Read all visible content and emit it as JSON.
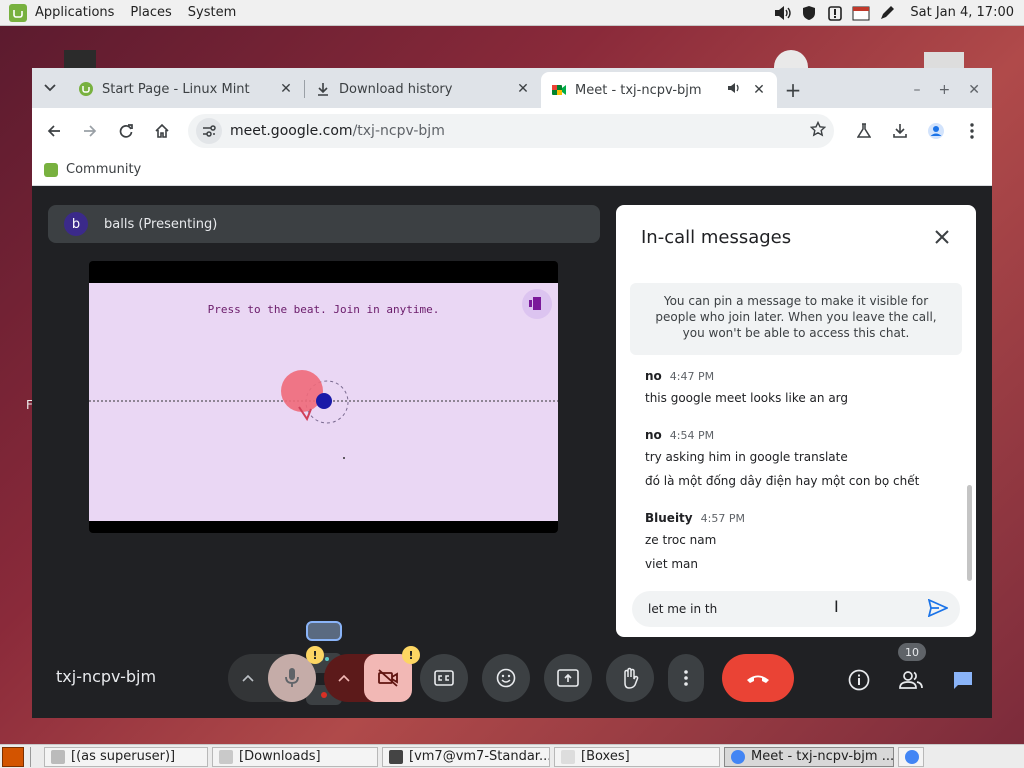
{
  "system_panel": {
    "menus": [
      "Applications",
      "Places",
      "System"
    ],
    "clock": "Sat Jan  4, 17:00"
  },
  "browser": {
    "tabs": [
      {
        "title": "Start Page - Linux Mint",
        "icon": "linux-mint-icon"
      },
      {
        "title": "Download history",
        "icon": "download-icon"
      },
      {
        "title": "Meet - txj-ncpv-bjm",
        "icon": "google-meet-icon",
        "audio": true
      }
    ],
    "url_host": "meet.google.com",
    "url_path": "/txj-ncpv-bjm",
    "bookmark": "Community"
  },
  "meet": {
    "presenter_initial": "b",
    "presenter_label": "balls (Presenting)",
    "slide_caption": "Press to the beat. Join in anytime.",
    "meeting_code": "txj-ncpv-bjm",
    "participant_count": "10",
    "warning_mark": "!"
  },
  "chat": {
    "title": "In-call messages",
    "info": "You can pin a message to make it visible for people who join later. When you leave the call, you won't be able to access this chat.",
    "groups": [
      {
        "sender": "no",
        "time": "4:47 PM",
        "lines": [
          "this google meet looks like an arg"
        ]
      },
      {
        "sender": "no",
        "time": "4:54 PM",
        "lines": [
          "try asking him in google translate",
          "đó là một đống dây điện hay một con bọ chết"
        ]
      },
      {
        "sender": "Blueity",
        "time": "4:57 PM",
        "lines": [
          "ze troc nam",
          "viet man"
        ]
      }
    ],
    "input_value": "let me in th"
  },
  "taskbar": {
    "tasks": [
      "[(as superuser)]",
      "[Downloads]",
      "[vm7@vm7-Standar...",
      "[Boxes]",
      "Meet - txj-ncpv-bjm ..."
    ]
  },
  "colors": {
    "meet_bg": "#202124",
    "end_call": "#ea4335",
    "accent_blue": "#1a73e8",
    "warning": "#fdd663"
  }
}
